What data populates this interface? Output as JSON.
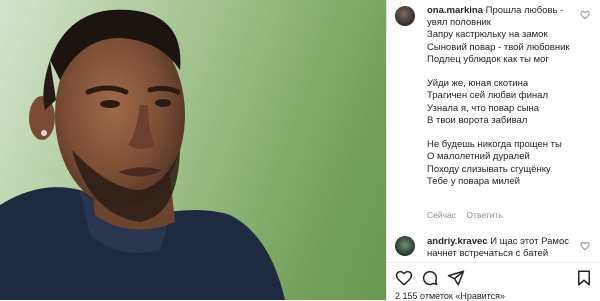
{
  "post": {
    "comments": [
      {
        "username": "ona.markina",
        "text": "Прошла любовь - увял половник\nЗапру кастрюльку на замок\nСыновий повар - твой любовник\nПодлец ублюдок как ты мог\n\nУйди же, юная скотина\nТрагичен сей любви финал\nУзнала я, что повар сына\nВ твои ворота забивал\n\nНе будешь никогда прощен ты\nО малолетний дуралей\nПоходу слизывать сгущёнку\nТебе у повара милей"
      },
      {
        "username": "andriy.kravec",
        "text": "И щас этот Рамос начнет встречаться с батей"
      }
    ],
    "comment_meta": {
      "time": "Сейчас",
      "reply": "Ответить"
    },
    "likes_text": "2 155 отметок «Нравится»"
  },
  "icons": {
    "heart_small": "heart-outline-icon",
    "like": "heart-icon",
    "comment": "comment-bubble-icon",
    "share": "paper-plane-icon",
    "save": "bookmark-icon"
  },
  "colors": {
    "text": "#262626",
    "muted": "#8e8e8e",
    "border": "#efefef"
  }
}
